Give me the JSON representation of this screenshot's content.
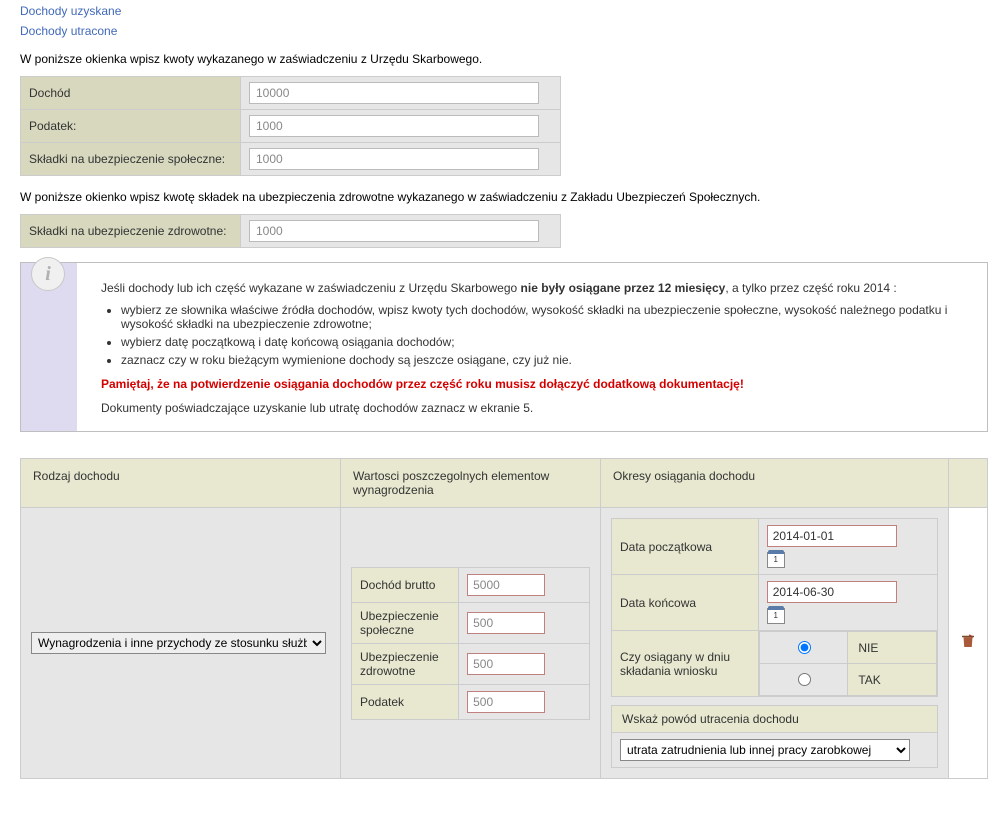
{
  "links": {
    "uzyskane": "Dochody uzyskane",
    "utracone": "Dochody utracone"
  },
  "para1": "W poniższe okienka wpisz kwoty wykazanego w zaświadczeniu z Urzędu Skarbowego.",
  "form1": {
    "rows": [
      {
        "label": "Dochód",
        "value": "10000"
      },
      {
        "label": "Podatek:",
        "value": "1000"
      },
      {
        "label": "Składki na ubezpieczenie społeczne:",
        "value": "1000"
      }
    ]
  },
  "para2": "W poniższe okienko wpisz kwotę składek na ubezpieczenia zdrowotne wykazanego w zaświadczeniu z Zakładu Ubezpieczeń Społecznych.",
  "form2": {
    "label": "Składki na ubezpieczenie zdrowotne:",
    "value": "1000"
  },
  "info": {
    "intro_before": "Jeśli dochody lub ich część wykazane w zaświadczeniu z Urzędu Skarbowego ",
    "intro_bold": "nie były osiągane przez 12 miesięcy",
    "intro_after": ", a tylko przez część roku 2014 :",
    "bullets": [
      "wybierz ze słownika właściwe źródła dochodów, wpisz kwoty tych dochodów, wysokość składki na ubezpieczenie społeczne, wysokość należnego podatku i wysokość składki na ubezpieczenie zdrowotne;",
      "wybierz datę początkową i datę końcową osiągania dochodów;",
      "zaznacz czy w roku bieżącym wymienione dochody są jeszcze osiągane, czy już nie."
    ],
    "warning": "Pamiętaj, że na potwierdzenie osiągania dochodów przez część roku musisz dołączyć dodatkową dokumentację!",
    "footer": "Dokumenty poświadczające uzyskanie lub utratę dochodów zaznacz w ekranie 5."
  },
  "main": {
    "headers": {
      "col1": "Rodzaj dochodu",
      "col2": "Wartosci poszczegolnych elementow wynagrodzenia",
      "col3": "Okresy osiągania dochodu"
    },
    "rodzaj_value": "Wynagrodzenia i inne przychody ze stosunku służb",
    "wartosci": [
      {
        "label": "Dochód brutto",
        "value": "5000"
      },
      {
        "label": "Ubezpieczenie społeczne",
        "value": "500"
      },
      {
        "label": "Ubezpieczenie zdrowotne",
        "value": "500"
      },
      {
        "label": "Podatek",
        "value": "500"
      }
    ],
    "okresy": {
      "data_pocz_label": "Data początkowa",
      "data_pocz_value": "2014-01-01",
      "data_konc_label": "Data końcowa",
      "data_konc_value": "2014-06-30",
      "czy_label": "Czy osiągany w dniu składania wniosku",
      "opt_nie": "NIE",
      "opt_tak": "TAK",
      "powod_label": "Wskaż powód utracenia dochodu",
      "powod_value": "utrata zatrudnienia lub innej pracy zarobkowej"
    }
  }
}
